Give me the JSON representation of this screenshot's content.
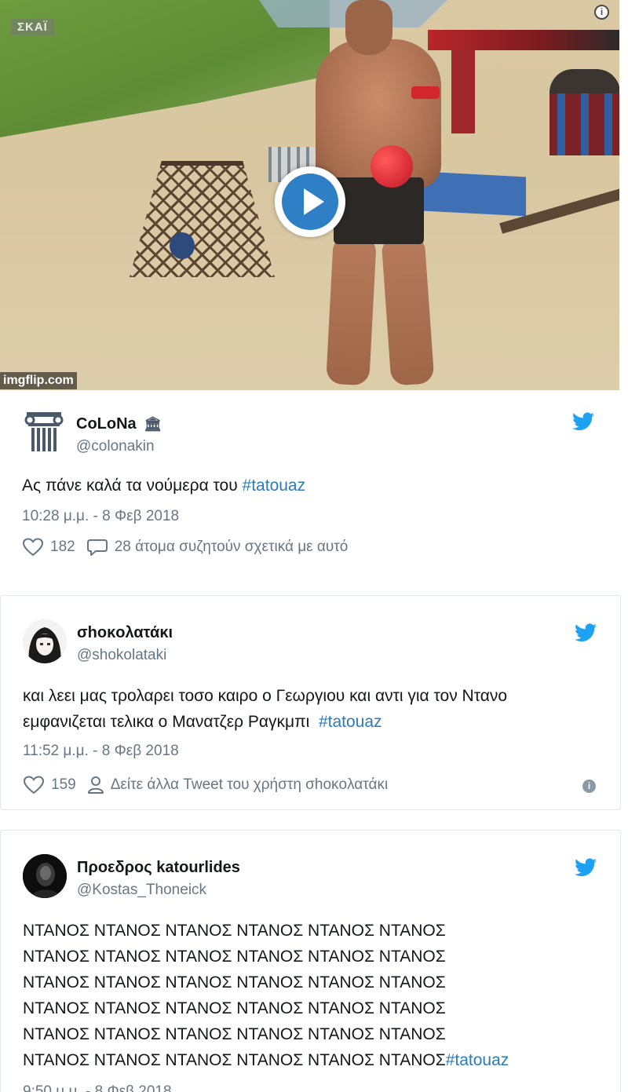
{
  "media": {
    "channel_logo": "ΣΚΑΪ",
    "watermark": "imgflip.com",
    "info_icon": "info-icon",
    "play_icon": "play-icon",
    "colors": {
      "play_button": "#2f7fc6"
    }
  },
  "tweets": [
    {
      "name": "CoLoNa",
      "name_badge": "🏛",
      "handle": "@colonakin",
      "text_before": "Ας πάνε καλά τα νούμερα του ",
      "hashtag": "#tatouaz",
      "time": "10:28 μ.μ. - 8 Φεβ 2018",
      "likes": "182",
      "secondary_action": "28 άτομα συζητούν σχετικά με αυτό"
    },
    {
      "name": "σhoκoλατάκι",
      "handle": "@shokolataki",
      "text_line1": "και λεει μας τρολαρει τοσο καιρο ο Γεωργιου και αντι για τον Ντανο",
      "text_line2_before": "εμφανιζεται τελικα ο Μανατζερ Ραγκμπι  ",
      "hashtag": "#tatouaz",
      "time": "11:52 μ.μ. - 8 Φεβ 2018",
      "likes": "159",
      "secondary_action": "Δείτε άλλα Tweet του χρήστη σhoκoλατάκι"
    },
    {
      "name": "Προεδρος katourlides",
      "handle": "@Kostas_Thoneick",
      "lines": [
        "ΝΤΑΝΟΣ ΝΤΑΝΟΣ ΝΤΑΝΟΣ ΝΤΑΝΟΣ ΝΤΑΝΟΣ ΝΤΑΝΟΣ",
        "ΝΤΑΝΟΣ ΝΤΑΝΟΣ ΝΤΑΝΟΣ ΝΤΑΝΟΣ ΝΤΑΝΟΣ ΝΤΑΝΟΣ",
        "ΝΤΑΝΟΣ ΝΤΑΝΟΣ ΝΤΑΝΟΣ ΝΤΑΝΟΣ ΝΤΑΝΟΣ ΝΤΑΝΟΣ",
        "ΝΤΑΝΟΣ ΝΤΑΝΟΣ ΝΤΑΝΟΣ ΝΤΑΝΟΣ ΝΤΑΝΟΣ ΝΤΑΝΟΣ",
        "ΝΤΑΝΟΣ ΝΤΑΝΟΣ ΝΤΑΝΟΣ ΝΤΑΝΟΣ ΝΤΑΝΟΣ ΝΤΑΝΟΣ"
      ],
      "last_line_before": "ΝΤΑΝΟΣ ΝΤΑΝΟΣ ΝΤΑΝΟΣ ΝΤΑΝΟΣ ΝΤΑΝΟΣ ΝΤΑΝΟΣ",
      "hashtag": "#tatouaz",
      "time_partial": "9:50 μ.μ. - 8 Φεβ 2018"
    }
  ],
  "icons": {
    "bird": "twitter-bird-icon",
    "heart": "heart-icon",
    "reply": "reply-bubble-icon",
    "person": "person-icon",
    "info": "info-icon"
  },
  "colors": {
    "twitter_blue": "#1da1f2",
    "hashtag": "#2b7bb9",
    "muted": "#657786",
    "text": "#14171a",
    "border": "#e1e8ed"
  }
}
